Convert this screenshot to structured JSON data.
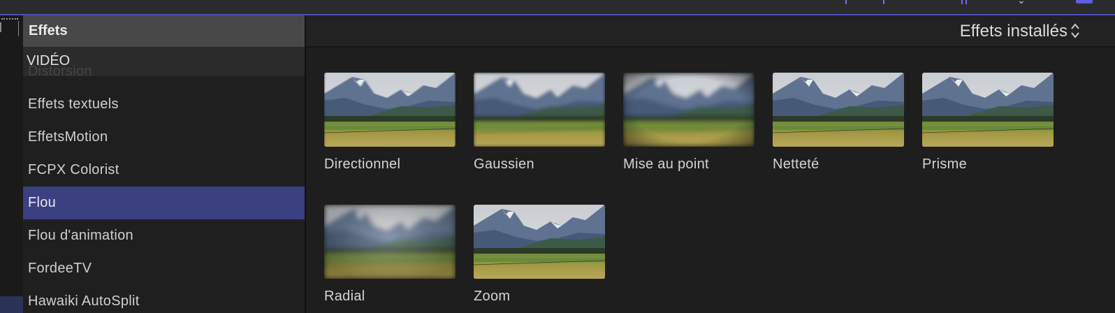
{
  "sidebar": {
    "header": "Effets",
    "section": "VIDÉO",
    "items": [
      {
        "label": "Distorsion"
      },
      {
        "label": "Effets textuels"
      },
      {
        "label": "EffetsMotion"
      },
      {
        "label": "FCPX Colorist"
      },
      {
        "label": "Flou",
        "active": true
      },
      {
        "label": "Flou d'animation"
      },
      {
        "label": "FordeeTV"
      },
      {
        "label": "Hawaiki AutoSplit"
      }
    ]
  },
  "browser": {
    "filter_label": "Effets installés",
    "effects": [
      {
        "name": "Directionnel",
        "blur": "directional"
      },
      {
        "name": "Gaussien",
        "blur": "gaussian"
      },
      {
        "name": "Mise au point",
        "blur": "focus"
      },
      {
        "name": "Netteté",
        "blur": "sharpen"
      },
      {
        "name": "Prisme",
        "blur": "prism"
      },
      {
        "name": "Radial",
        "blur": "radial"
      },
      {
        "name": "Zoom",
        "blur": "zoom"
      }
    ]
  },
  "colors": {
    "accent": "#3a4080",
    "background": "#1e1e1e",
    "header": "#484848"
  }
}
